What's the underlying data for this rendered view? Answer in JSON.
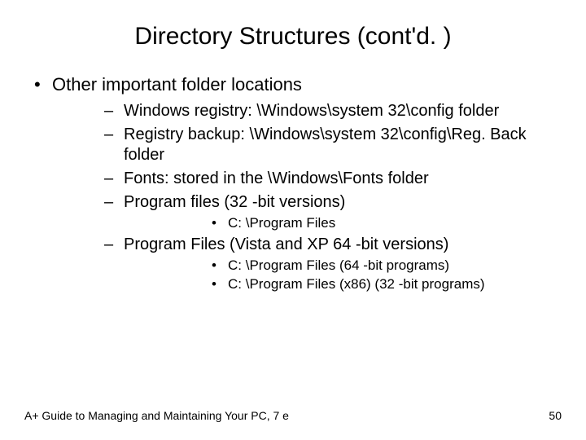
{
  "title": "Directory Structures (cont'd. )",
  "bullets": {
    "top": "Other important folder locations",
    "sub": [
      "Windows registry: \\Windows\\system 32\\config folder",
      "Registry backup: \\Windows\\system 32\\config\\Reg. Back folder",
      "Fonts: stored in the \\Windows\\Fonts folder",
      "Program files (32 -bit versions)",
      "Program Files (Vista and XP 64 -bit versions)"
    ],
    "sub3a": [
      "C: \\Program Files"
    ],
    "sub3b": [
      "C: \\Program Files (64 -bit programs)",
      "C: \\Program Files (x86) (32 -bit programs)"
    ]
  },
  "footer": {
    "left": "A+ Guide to Managing and Maintaining Your PC, 7 e",
    "right": "50"
  }
}
